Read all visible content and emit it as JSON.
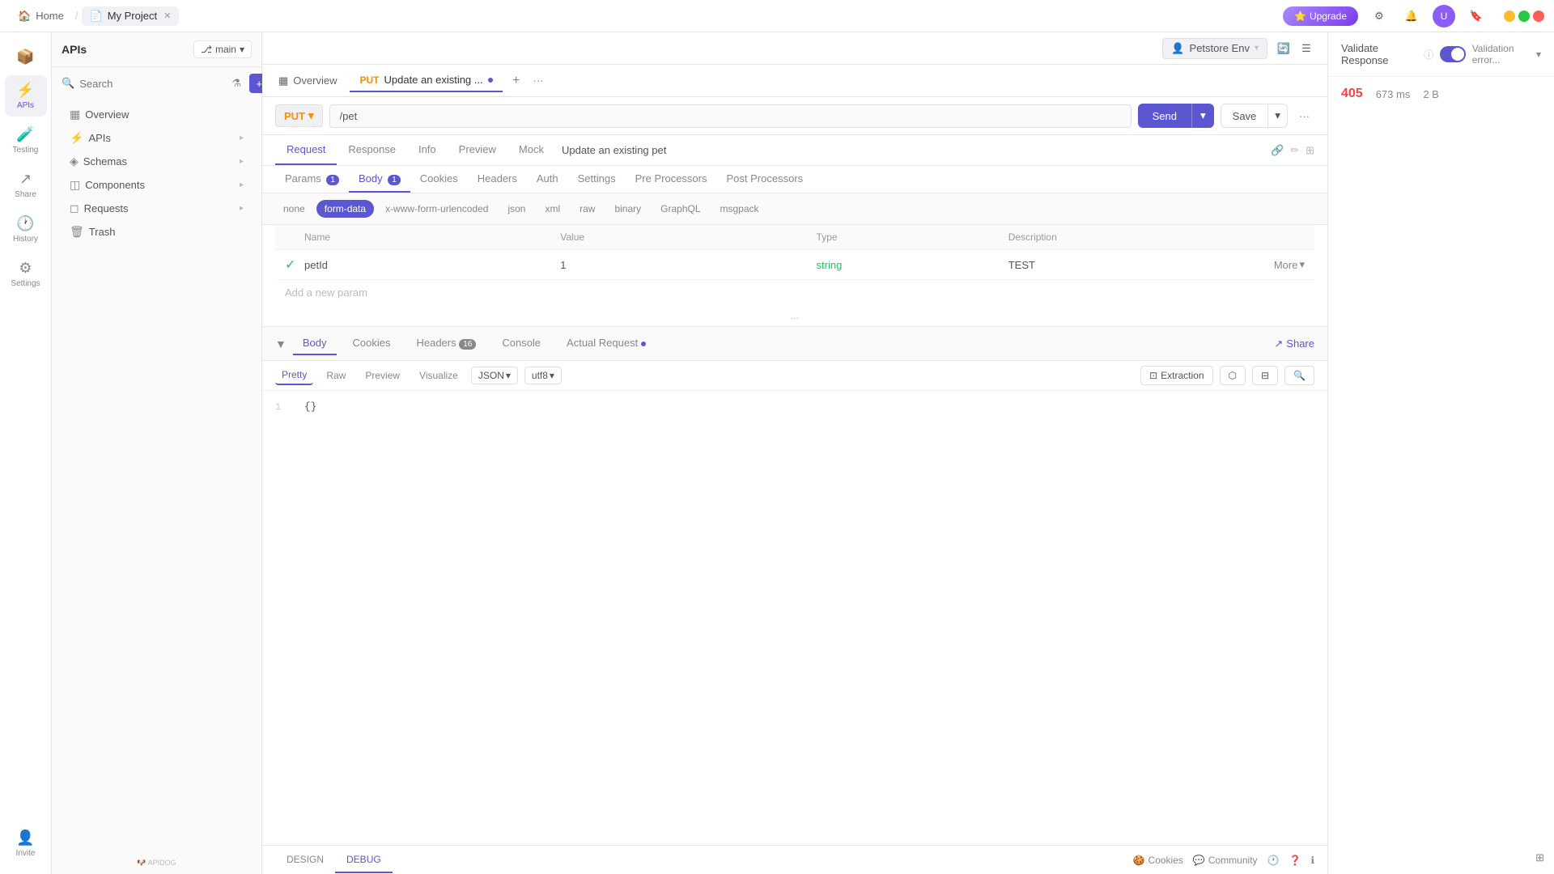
{
  "titlebar": {
    "home_label": "Home",
    "project_tab": "My Project",
    "upgrade_label": "Upgrade",
    "upgrade_icon": "⭐"
  },
  "sidebar": {
    "app_icon": "📦",
    "items": [
      {
        "id": "apis",
        "icon": "⚡",
        "label": "APIs",
        "active": true
      },
      {
        "id": "testing",
        "icon": "🧪",
        "label": "Testing",
        "active": false
      },
      {
        "id": "share",
        "icon": "↗",
        "label": "Share",
        "active": false
      },
      {
        "id": "history",
        "icon": "🕐",
        "label": "History",
        "active": false
      },
      {
        "id": "settings",
        "icon": "⚙",
        "label": "Settings",
        "active": false
      }
    ],
    "invite_label": "Invite",
    "logo_text": "APIDOG"
  },
  "left_panel": {
    "title": "APIs",
    "branch_label": "main",
    "search_placeholder": "Search",
    "nav_items": [
      {
        "id": "overview",
        "icon": "▦",
        "label": "Overview",
        "has_arrow": false
      },
      {
        "id": "apis",
        "icon": "⚡",
        "label": "APIs",
        "has_arrow": true
      },
      {
        "id": "schemas",
        "icon": "◈",
        "label": "Schemas",
        "has_arrow": true
      },
      {
        "id": "components",
        "icon": "◫",
        "label": "Components",
        "has_arrow": true
      },
      {
        "id": "requests",
        "icon": "◻",
        "label": "Requests",
        "has_arrow": true
      },
      {
        "id": "trash",
        "icon": "🗑",
        "label": "Trash",
        "has_arrow": false
      }
    ]
  },
  "tabs": {
    "overview_tab": "Overview",
    "active_tab_method": "PUT",
    "active_tab_label": "Update an existing ...",
    "active_tab_dot": true
  },
  "request": {
    "method": "PUT",
    "url": "/pet",
    "send_label": "Send",
    "save_label": "Save"
  },
  "sub_tabs": [
    {
      "id": "request",
      "label": "Request",
      "active": true
    },
    {
      "id": "response",
      "label": "Response",
      "active": false
    },
    {
      "id": "info",
      "label": "Info",
      "active": false
    },
    {
      "id": "preview",
      "label": "Preview",
      "active": false
    },
    {
      "id": "mock",
      "label": "Mock",
      "active": false
    }
  ],
  "api_title": "Update an existing pet",
  "body_tabs": [
    {
      "id": "params",
      "label": "Params",
      "badge": "1",
      "active": false
    },
    {
      "id": "body",
      "label": "Body",
      "badge": "1",
      "active": true
    },
    {
      "id": "cookies",
      "label": "Cookies",
      "active": false
    },
    {
      "id": "headers",
      "label": "Headers",
      "active": false
    },
    {
      "id": "auth",
      "label": "Auth",
      "active": false
    },
    {
      "id": "settings",
      "label": "Settings",
      "active": false
    },
    {
      "id": "pre_processors",
      "label": "Pre Processors",
      "active": false
    },
    {
      "id": "post_processors",
      "label": "Post Processors",
      "active": false
    }
  ],
  "format_tabs": [
    {
      "id": "none",
      "label": "none",
      "active": false
    },
    {
      "id": "form-data",
      "label": "form-data",
      "active": true
    },
    {
      "id": "x-www-form-urlencoded",
      "label": "x-www-form-urlencoded",
      "active": false
    },
    {
      "id": "json",
      "label": "json",
      "active": false
    },
    {
      "id": "xml",
      "label": "xml",
      "active": false
    },
    {
      "id": "raw",
      "label": "raw",
      "active": false
    },
    {
      "id": "binary",
      "label": "binary",
      "active": false
    },
    {
      "id": "graphql",
      "label": "GraphQL",
      "active": false
    },
    {
      "id": "msgpack",
      "label": "msgpack",
      "active": false
    }
  ],
  "table": {
    "headers": [
      "Name",
      "Value",
      "Type",
      "Description"
    ],
    "rows": [
      {
        "enabled": true,
        "name": "petId",
        "value": "1",
        "type": "string",
        "description": "TEST"
      }
    ],
    "add_param_label": "Add a new param"
  },
  "response": {
    "section_divider": "...",
    "tabs": [
      {
        "id": "body",
        "label": "Body",
        "active": true
      },
      {
        "id": "cookies",
        "label": "Cookies",
        "active": false
      },
      {
        "id": "headers",
        "label": "Headers",
        "badge": "16",
        "active": false
      },
      {
        "id": "console",
        "label": "Console",
        "active": false
      },
      {
        "id": "actual_request",
        "label": "Actual Request",
        "dot": true,
        "active": false
      }
    ],
    "share_label": "Share",
    "format_tabs": [
      {
        "id": "pretty",
        "label": "Pretty",
        "active": true
      },
      {
        "id": "raw",
        "label": "Raw",
        "active": false
      },
      {
        "id": "preview",
        "label": "Preview",
        "active": false
      },
      {
        "id": "visualize",
        "label": "Visualize",
        "active": false
      }
    ],
    "format_dropdown": "JSON",
    "encoding_dropdown": "utf8",
    "extraction_label": "Extraction",
    "body_line_1": "1",
    "body_content": "{}",
    "validate_label": "Validate Response",
    "validation_error_label": "Validation error...",
    "status_code": "405",
    "response_time": "673 ms",
    "response_size": "2 B"
  },
  "bottom": {
    "design_tab": "DESIGN",
    "debug_tab": "DEBUG",
    "cookies_label": "Cookies",
    "community_label": "Community"
  }
}
